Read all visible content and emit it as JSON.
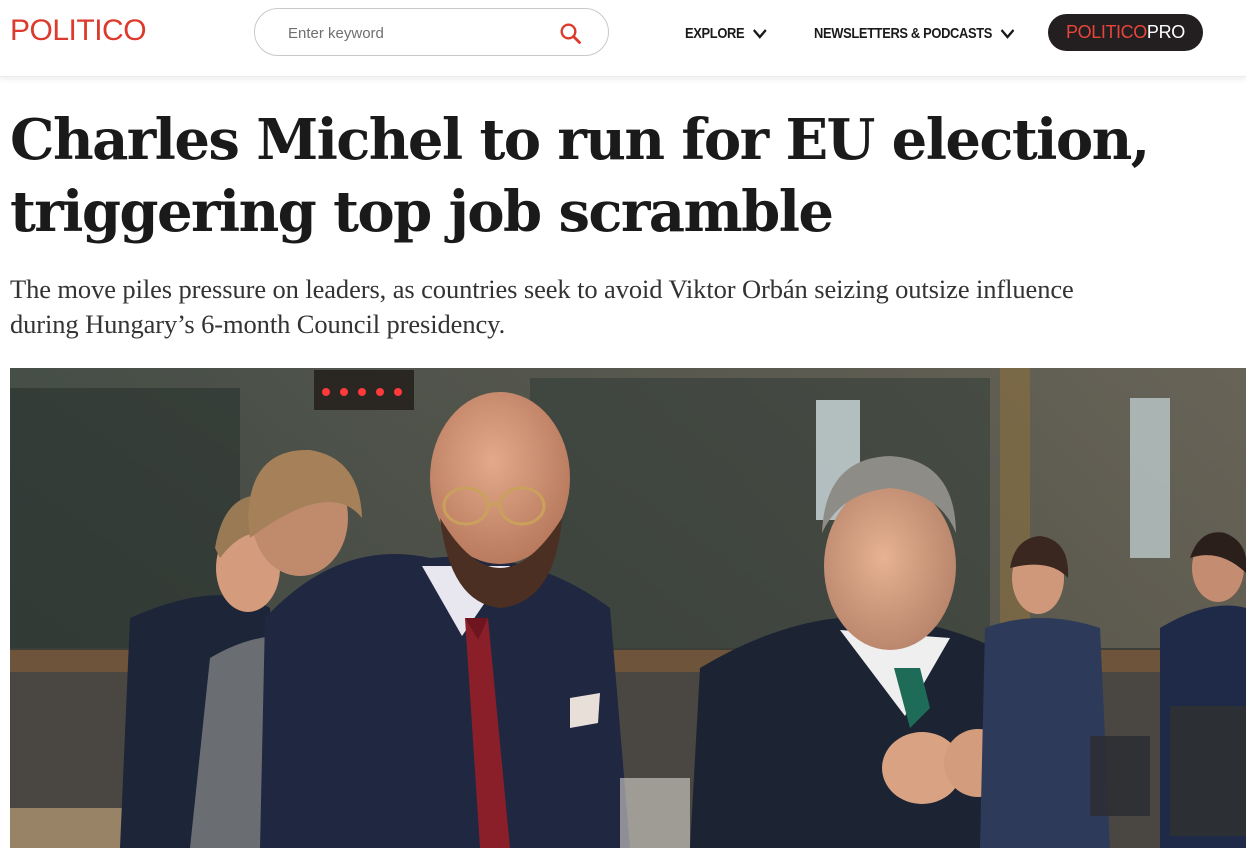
{
  "header": {
    "logo": "POLITICO",
    "search": {
      "placeholder": "Enter keyword",
      "value": ""
    },
    "nav": [
      {
        "label": "EXPLORE"
      },
      {
        "label": "NEWSLETTERS & PODCASTS"
      }
    ],
    "pro_button": {
      "part1": "POLITICO",
      "part2": "PRO"
    }
  },
  "article": {
    "headline": "Charles Michel to run for EU election, triggering top job scramble",
    "dek": "The move piles pressure on leaders, as countries seek to avoid Viktor Orbán seizing outsize influence during Hungary’s 6-month Council presidency."
  },
  "colors": {
    "brand_red": "#dc3a2d",
    "pro_bg": "#231f20",
    "text_dark": "#1a1a1a"
  },
  "icons": {
    "search": "search-icon",
    "dropdown": "chevron-down-icon"
  }
}
